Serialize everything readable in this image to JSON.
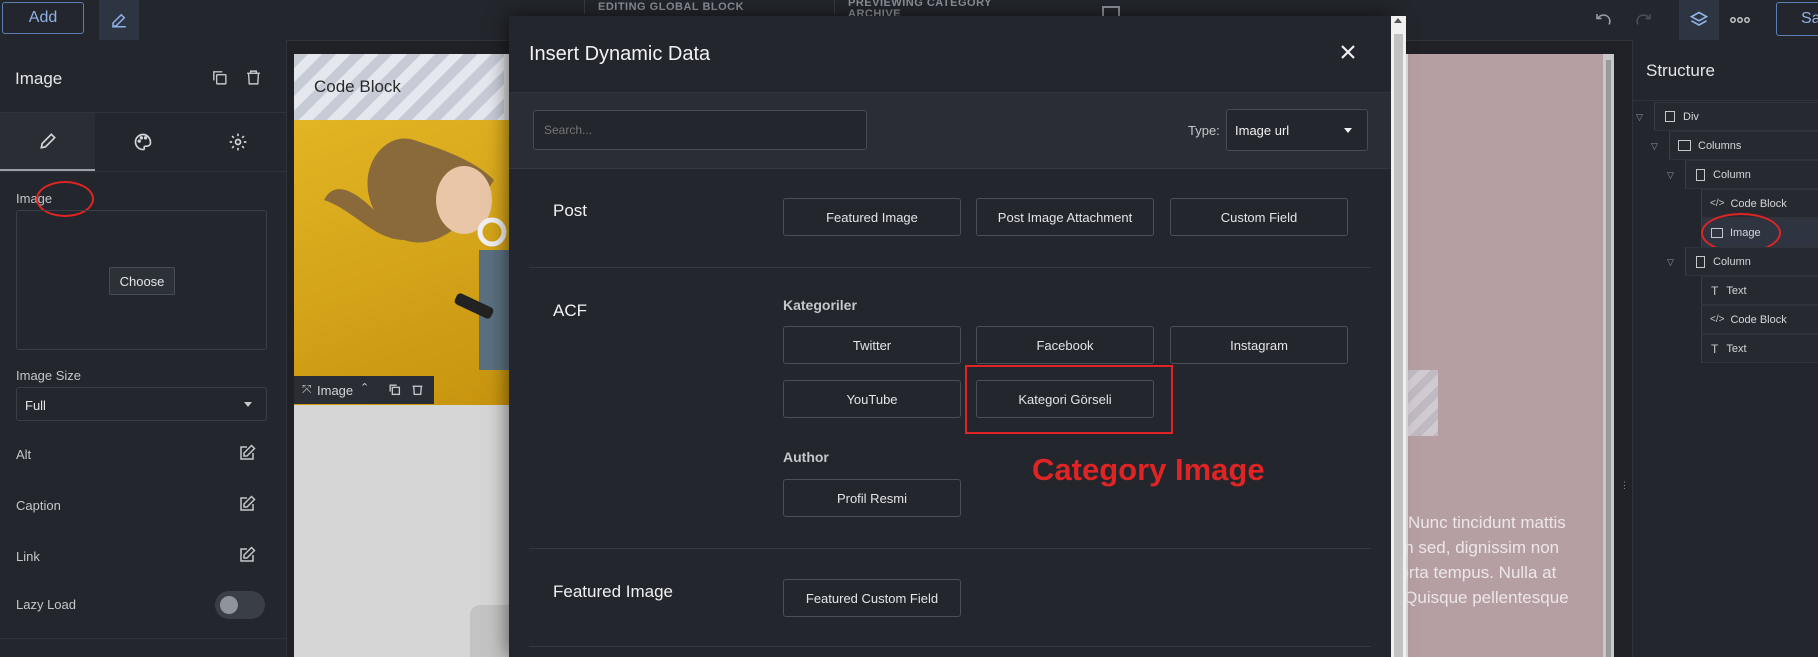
{
  "topbar": {
    "add_label": "Add",
    "editing_label": "EDITING GLOBAL BLOCK",
    "previewing_label": "PREVIEWING CATEGORY ARCHIVE",
    "save_label": "Sa"
  },
  "left_panel": {
    "title": "Image",
    "fields": {
      "image_label": "Image",
      "choose_label": "Choose",
      "image_size_label": "Image Size",
      "image_size_value": "Full",
      "alt_label": "Alt",
      "caption_label": "Caption",
      "link_label": "Link",
      "lazy_load_label": "Lazy Load"
    }
  },
  "canvas": {
    "code_block_label": "Code Block",
    "image_bar_label": "Image",
    "text_lines": [
      "it. Nunc tincidunt mattis",
      "um sed, dignissim non",
      "porta tempus. Nulla at",
      "t. Quisque pellentesque"
    ]
  },
  "structure": {
    "title": "Structure",
    "items": [
      {
        "label": "Div"
      },
      {
        "label": "Columns"
      },
      {
        "label": "Column"
      },
      {
        "label": "Code Block"
      },
      {
        "label": "Image"
      },
      {
        "label": "Column"
      },
      {
        "label": "Text"
      },
      {
        "label": "Code Block"
      },
      {
        "label": "Text"
      }
    ]
  },
  "modal": {
    "title": "Insert Dynamic Data",
    "search_placeholder": "Search...",
    "type_label": "Type:",
    "type_value": "Image url",
    "sections": {
      "post": {
        "label": "Post",
        "buttons": [
          "Featured Image",
          "Post Image Attachment",
          "Custom Field"
        ]
      },
      "acf": {
        "label": "ACF",
        "group1_label": "Kategoriler",
        "group1_buttons": [
          "Twitter",
          "Facebook",
          "Instagram",
          "YouTube",
          "Kategori Görseli"
        ],
        "group2_label": "Author",
        "group2_buttons": [
          "Profil Resmi"
        ]
      },
      "featured_image": {
        "label": "Featured Image",
        "buttons": [
          "Featured Custom Field"
        ]
      }
    },
    "annotation": "Category Image"
  },
  "colors": {
    "accent_blue": "#8fb3e6",
    "annotation_red": "#e02424",
    "panel_bg": "#23262c"
  }
}
